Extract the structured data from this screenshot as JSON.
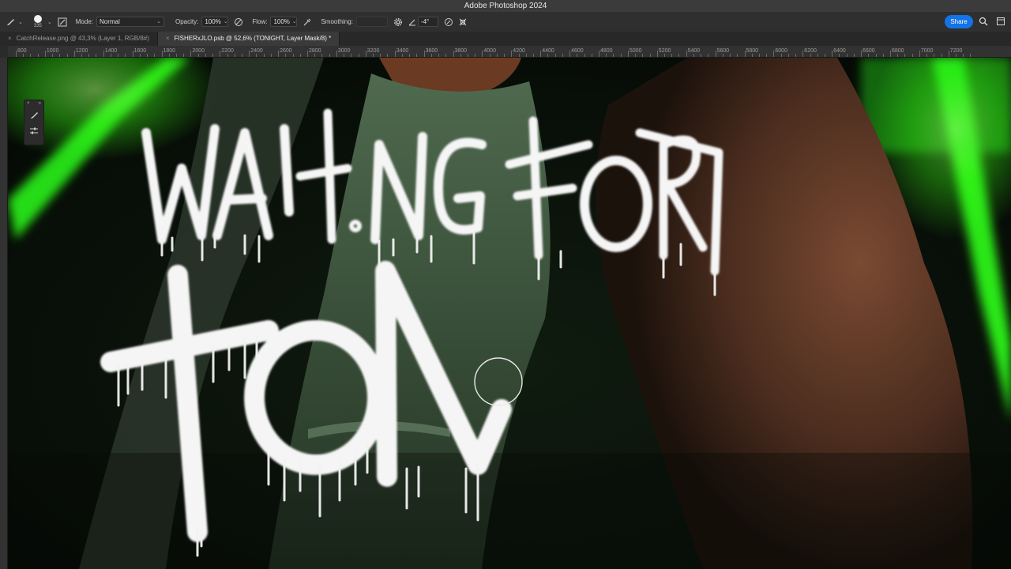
{
  "app": {
    "title": "Adobe Photoshop 2024"
  },
  "options_bar": {
    "brush_size": "335",
    "mode_label": "Mode:",
    "mode_value": "Normal",
    "opacity_label": "Opacity:",
    "opacity_value": "100%",
    "flow_label": "Flow:",
    "flow_value": "100%",
    "smoothing_label": "Smoothing:",
    "smoothing_value": "",
    "angle_value": "-4°",
    "share_label": "Share"
  },
  "tabs": [
    {
      "label": "CatchRelease.png @ 43,3% (Layer 1, RGB/8#)",
      "active": false
    },
    {
      "label": "FISHERxJLO.psb @ 52,6% (TONIGHT, Layer Mask/8) *",
      "active": true
    }
  ],
  "ruler": {
    "labels": [
      "800",
      "1000",
      "1200",
      "1400",
      "1600",
      "1800",
      "2000",
      "2200",
      "2400",
      "2600",
      "2800",
      "3000",
      "3200",
      "3400",
      "3600",
      "3800",
      "4000",
      "4200",
      "4400",
      "4600",
      "4800",
      "5000",
      "5200",
      "5400",
      "5600",
      "5800",
      "6000",
      "6200",
      "6400",
      "6600",
      "6800",
      "7000",
      "7200"
    ]
  },
  "canvas": {
    "graffiti_line1": "WAITING FOR",
    "graffiti_line2": "TON"
  },
  "colors": {
    "accent": "#1473e6",
    "neon_green": "#39ff14",
    "fur_brown": "#7a4a32",
    "paint_white": "#f5f5f5"
  }
}
